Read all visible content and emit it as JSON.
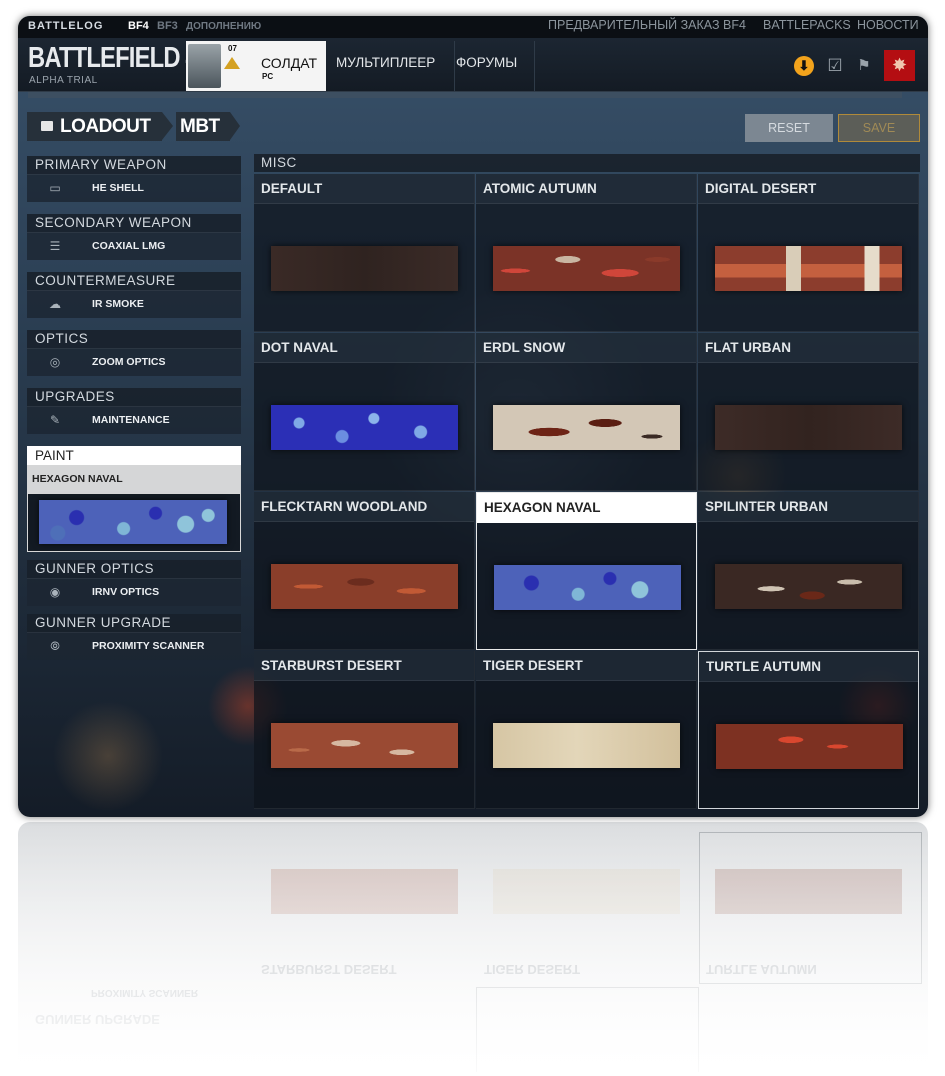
{
  "topbar": {
    "brand": "BATTLELOG",
    "games": [
      "BF4",
      "BF3"
    ],
    "addons": "ДОПОЛНЕНИЮ",
    "links": [
      "ПРЕДВАРИТЕЛЬНЫЙ ЗАКАЗ BF4",
      "BATTLEPACKS",
      "НОВОСТИ"
    ]
  },
  "header": {
    "logo": "BATTLEFIELD 4",
    "logo_sub": "ALPHA TRIAL",
    "soldier": {
      "rank": "07",
      "label": "СОЛДАТ",
      "platform": "PC"
    },
    "nav": [
      "МУЛЬТИПЛЕЕР",
      "ФОРУМЫ"
    ],
    "icons": [
      "download-icon",
      "clipboard-icon",
      "flag-icon",
      "emblem-icon"
    ]
  },
  "breadcrumb": {
    "loadout": "LOADOUT",
    "vehicle": "MBT"
  },
  "actions": {
    "reset": "RESET",
    "save": "SAVE"
  },
  "categories": [
    {
      "title": "PRIMARY WEAPON",
      "item": "HE SHELL",
      "icon": "shell-icon"
    },
    {
      "title": "SECONDARY WEAPON",
      "item": "COAXIAL LMG",
      "icon": "lmg-icon"
    },
    {
      "title": "COUNTERMEASURE",
      "item": "IR SMOKE",
      "icon": "smoke-icon"
    },
    {
      "title": "OPTICS",
      "item": "ZOOM OPTICS",
      "icon": "optics-icon"
    },
    {
      "title": "UPGRADES",
      "item": "MAINTENANCE",
      "icon": "wrench-icon"
    }
  ],
  "paint": {
    "title": "PAINT",
    "selected": "HEXAGON NAVAL"
  },
  "categories_after": [
    {
      "title": "GUNNER OPTICS",
      "item": "IRNV OPTICS",
      "icon": "irnv-icon"
    },
    {
      "title": "GUNNER UPGRADE",
      "item": "PROXIMITY SCANNER",
      "icon": "scanner-icon"
    }
  ],
  "grid": {
    "title": "MISC",
    "tiles": [
      {
        "name": "DEFAULT"
      },
      {
        "name": "ATOMIC AUTUMN"
      },
      {
        "name": "DIGITAL DESERT"
      },
      {
        "name": "DOT NAVAL"
      },
      {
        "name": "ERDL SNOW"
      },
      {
        "name": "FLAT URBAN"
      },
      {
        "name": "FLECKTARN WOODLAND"
      },
      {
        "name": "HEXAGON NAVAL"
      },
      {
        "name": "SPILINTER URBAN"
      },
      {
        "name": "STARBURST DESERT"
      },
      {
        "name": "TIGER DESERT"
      },
      {
        "name": "TURTLE AUTUMN"
      }
    ]
  },
  "colors": {
    "accent": "#f2a31c",
    "emblem": "#b40e12",
    "save_border": "#b08a3a"
  }
}
